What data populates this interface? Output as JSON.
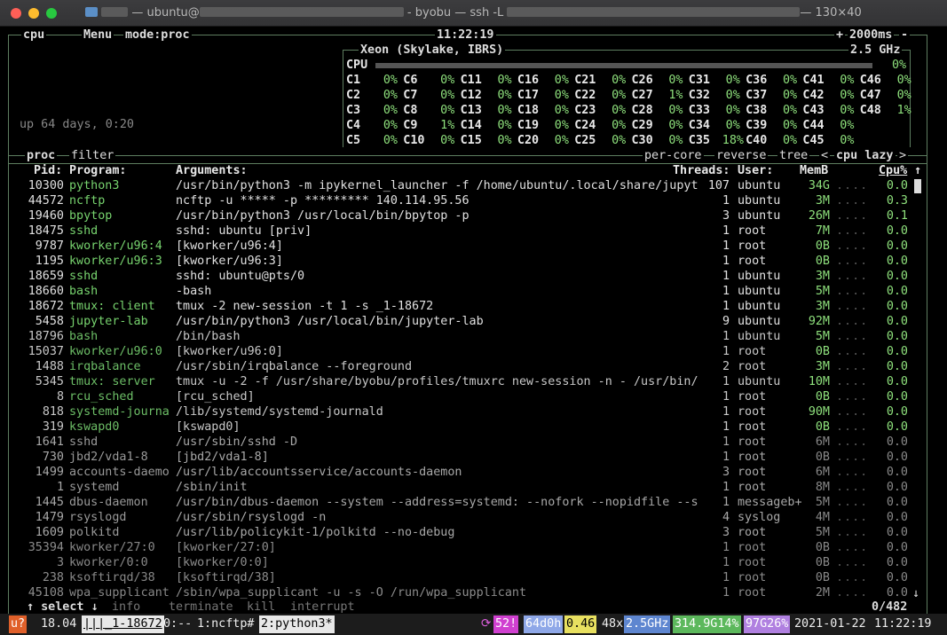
{
  "window": {
    "title_pre": "— ubuntu@",
    "title_mid": " - byobu — ssh -L ",
    "title_post": "— 130×40",
    "title_user": "▆▆▆",
    "redact1": "",
    "redact2": ""
  },
  "cpu_box": {
    "tab_cpu": "cpu",
    "tab_menu": "Menu",
    "tab_mode": "mode:proc",
    "clock": "11:22:19",
    "interval": "2000ms",
    "plus": "+",
    "minus": "-",
    "uptime": "up 64 days, 0:20",
    "cpu_model": "Xeon (Skylake, IBRS)",
    "freq": "2.5 GHz",
    "cpu_label": "CPU",
    "cpu_total": "0%"
  },
  "cores": [
    [
      "C1",
      "0%",
      "C6",
      "0%",
      "C11",
      "0%",
      "C16",
      "0%",
      "C21",
      "0%",
      "C26",
      "0%",
      "C31",
      "0%",
      "C36",
      "0%",
      "C41",
      "0%",
      "C46",
      "0%"
    ],
    [
      "C2",
      "0%",
      "C7",
      "0%",
      "C12",
      "0%",
      "C17",
      "0%",
      "C22",
      "0%",
      "C27",
      "1%",
      "C32",
      "0%",
      "C37",
      "0%",
      "C42",
      "0%",
      "C47",
      "0%"
    ],
    [
      "C3",
      "0%",
      "C8",
      "0%",
      "C13",
      "0%",
      "C18",
      "0%",
      "C23",
      "0%",
      "C28",
      "0%",
      "C33",
      "0%",
      "C38",
      "0%",
      "C43",
      "0%",
      "C48",
      "1%"
    ],
    [
      "C4",
      "0%",
      "C9",
      "1%",
      "C14",
      "0%",
      "C19",
      "0%",
      "C24",
      "0%",
      "C29",
      "0%",
      "C34",
      "0%",
      "C39",
      "0%",
      "C44",
      "0%",
      "",
      ""
    ],
    [
      "C5",
      "0%",
      "C10",
      "0%",
      "C15",
      "0%",
      "C20",
      "0%",
      "C25",
      "0%",
      "C30",
      "0%",
      "C35",
      "18%",
      "C40",
      "0%",
      "C45",
      "0%",
      "",
      ""
    ]
  ],
  "proc_box": {
    "tab_proc": "proc",
    "tab_filter": "filter",
    "per_core": "per-core",
    "reverse": "reverse",
    "tree": "tree",
    "lt": "<",
    "sort": "cpu lazy",
    "gt": ">",
    "count": "0/482",
    "select": "↑ select ↓",
    "info": "info",
    "terminate": "terminate",
    "kill": "kill",
    "interrupt": "interrupt"
  },
  "columns": {
    "pid": "Pid:",
    "program": "Program:",
    "args": "Arguments:",
    "threads": "Threads:",
    "user": "User:",
    "mem": "MemB",
    "cpu": "Cpu%",
    "arrow": "↑"
  },
  "processes": [
    {
      "pid": "10300",
      "prog": "python3",
      "args": "/usr/bin/python3 -m ipykernel_launcher -f /home/ubuntu/.local/share/jupyt",
      "thr": "107",
      "user": "ubuntu",
      "mem": "34G",
      "cpu": "0.0",
      "lvl": 0
    },
    {
      "pid": "44572",
      "prog": "ncftp",
      "args": "ncftp -u ***** -p ********* 140.114.95.56",
      "thr": "1",
      "user": "ubuntu",
      "mem": "3M",
      "cpu": "0.3",
      "lvl": 0
    },
    {
      "pid": "19460",
      "prog": "bpytop",
      "args": "/usr/bin/python3 /usr/local/bin/bpytop -p",
      "thr": "3",
      "user": "ubuntu",
      "mem": "26M",
      "cpu": "0.1",
      "lvl": 0
    },
    {
      "pid": "18475",
      "prog": "sshd",
      "args": "sshd: ubuntu [priv]",
      "thr": "1",
      "user": "root",
      "mem": "7M",
      "cpu": "0.0",
      "lvl": 0
    },
    {
      "pid": "9787",
      "prog": "kworker/u96:4",
      "args": "[kworker/u96:4]",
      "thr": "1",
      "user": "root",
      "mem": "0B",
      "cpu": "0.0",
      "lvl": 0
    },
    {
      "pid": "1195",
      "prog": "kworker/u96:3",
      "args": "[kworker/u96:3]",
      "thr": "1",
      "user": "root",
      "mem": "0B",
      "cpu": "0.0",
      "lvl": 0
    },
    {
      "pid": "18659",
      "prog": "sshd",
      "args": "sshd: ubuntu@pts/0",
      "thr": "1",
      "user": "ubuntu",
      "mem": "3M",
      "cpu": "0.0",
      "lvl": 0
    },
    {
      "pid": "18660",
      "prog": "bash",
      "args": "-bash",
      "thr": "1",
      "user": "ubuntu",
      "mem": "5M",
      "cpu": "0.0",
      "lvl": 0
    },
    {
      "pid": "18672",
      "prog": "tmux: client",
      "args": "tmux -2 new-session -t 1 -s _1-18672",
      "thr": "1",
      "user": "ubuntu",
      "mem": "3M",
      "cpu": "0.0",
      "lvl": 0
    },
    {
      "pid": "5458",
      "prog": "jupyter-lab",
      "args": "/usr/bin/python3 /usr/local/bin/jupyter-lab",
      "thr": "9",
      "user": "ubuntu",
      "mem": "92M",
      "cpu": "0.0",
      "lvl": 0
    },
    {
      "pid": "18796",
      "prog": "bash",
      "args": "/bin/bash",
      "thr": "1",
      "user": "ubuntu",
      "mem": "5M",
      "cpu": "0.0",
      "lvl": 1
    },
    {
      "pid": "15037",
      "prog": "kworker/u96:0",
      "args": "[kworker/u96:0]",
      "thr": "1",
      "user": "root",
      "mem": "0B",
      "cpu": "0.0",
      "lvl": 1
    },
    {
      "pid": "1488",
      "prog": "irqbalance",
      "args": "/usr/sbin/irqbalance --foreground",
      "thr": "2",
      "user": "root",
      "mem": "3M",
      "cpu": "0.0",
      "lvl": 1
    },
    {
      "pid": "5345",
      "prog": "tmux: server",
      "args": "tmux -u -2 -f /usr/share/byobu/profiles/tmuxrc new-session -n - /usr/bin/",
      "thr": "1",
      "user": "ubuntu",
      "mem": "10M",
      "cpu": "0.0",
      "lvl": 1
    },
    {
      "pid": "8",
      "prog": "rcu_sched",
      "args": "[rcu_sched]",
      "thr": "1",
      "user": "root",
      "mem": "0B",
      "cpu": "0.0",
      "lvl": 1
    },
    {
      "pid": "818",
      "prog": "systemd-journa",
      "args": "/lib/systemd/systemd-journald",
      "thr": "1",
      "user": "root",
      "mem": "90M",
      "cpu": "0.0",
      "lvl": 1
    },
    {
      "pid": "319",
      "prog": "kswapd0",
      "args": "[kswapd0]",
      "thr": "1",
      "user": "root",
      "mem": "0B",
      "cpu": "0.0",
      "lvl": 1
    },
    {
      "pid": "1641",
      "prog": "sshd",
      "args": "/usr/sbin/sshd -D",
      "thr": "1",
      "user": "root",
      "mem": "6M",
      "cpu": "0.0",
      "lvl": 2
    },
    {
      "pid": "730",
      "prog": "jbd2/vda1-8",
      "args": "[jbd2/vda1-8]",
      "thr": "1",
      "user": "root",
      "mem": "0B",
      "cpu": "0.0",
      "lvl": 2
    },
    {
      "pid": "1499",
      "prog": "accounts-daemo",
      "args": "/usr/lib/accountsservice/accounts-daemon",
      "thr": "3",
      "user": "root",
      "mem": "6M",
      "cpu": "0.0",
      "lvl": 2
    },
    {
      "pid": "1",
      "prog": "systemd",
      "args": "/sbin/init",
      "thr": "1",
      "user": "root",
      "mem": "8M",
      "cpu": "0.0",
      "lvl": 2
    },
    {
      "pid": "1445",
      "prog": "dbus-daemon",
      "args": "/usr/bin/dbus-daemon --system --address=systemd: --nofork --nopidfile --s",
      "thr": "1",
      "user": "messageb+",
      "mem": "5M",
      "cpu": "0.0",
      "lvl": 2
    },
    {
      "pid": "1479",
      "prog": "rsyslogd",
      "args": "/usr/sbin/rsyslogd -n",
      "thr": "4",
      "user": "syslog",
      "mem": "4M",
      "cpu": "0.0",
      "lvl": 2
    },
    {
      "pid": "1609",
      "prog": "polkitd",
      "args": "/usr/lib/policykit-1/polkitd --no-debug",
      "thr": "3",
      "user": "root",
      "mem": "5M",
      "cpu": "0.0",
      "lvl": 2
    },
    {
      "pid": "35394",
      "prog": "kworker/27:0",
      "args": "[kworker/27:0]",
      "thr": "1",
      "user": "root",
      "mem": "0B",
      "cpu": "0.0",
      "lvl": 3
    },
    {
      "pid": "3",
      "prog": "kworker/0:0",
      "args": "[kworker/0:0]",
      "thr": "1",
      "user": "root",
      "mem": "0B",
      "cpu": "0.0",
      "lvl": 3
    },
    {
      "pid": "238",
      "prog": "ksoftirqd/38",
      "args": "[ksoftirqd/38]",
      "thr": "1",
      "user": "root",
      "mem": "0B",
      "cpu": "0.0",
      "lvl": 3
    },
    {
      "pid": "45108",
      "prog": "wpa_supplicant",
      "args": "/sbin/wpa_supplicant -u -s -O /run/wpa_supplicant",
      "thr": "1",
      "user": "root",
      "mem": "2M",
      "cpu": "0.0",
      "lvl": 3
    }
  ],
  "statusbar": {
    "os": "u?",
    "load": "18.04",
    "sess": "|||_1-18672",
    "win0": "0:--",
    "win1": "1:ncftp#",
    "win2": "2:python3*",
    "refresh": "⟳",
    "procs": "52!",
    "uptime": "64d0h",
    "loadavg": "0.46",
    "cpus": "48x",
    "ghz": "2.5GHz",
    "mem": "314.9G14%",
    "disk": "97G26%",
    "date": "2021-01-22",
    "time": "11:22:19",
    "scroll_down": "↓"
  },
  "colors": {
    "border": "#5e7e60",
    "program": "#77d36e",
    "mem": "#8ee07c",
    "cpu": "#8ee07c"
  }
}
